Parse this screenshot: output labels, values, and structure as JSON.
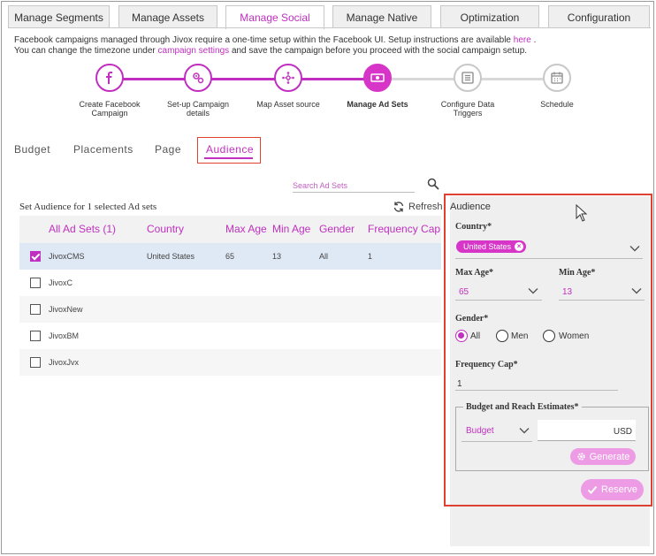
{
  "tabs": [
    {
      "label": "Manage Segments"
    },
    {
      "label": "Manage Assets"
    },
    {
      "label": "Manage Social",
      "active": true
    },
    {
      "label": "Manage Native"
    },
    {
      "label": "Optimization"
    },
    {
      "label": "Configuration"
    }
  ],
  "info": {
    "line1_prefix": "Facebook campaigns managed through Jivox require a one-time setup within the Facebook UI. Setup instructions are available",
    "line1_link": "here",
    "line1_suffix": ".",
    "line2_prefix": "You can change the timezone under",
    "line2_link": "campaign settings",
    "line2_suffix": "and save the campaign before you proceed with the social campaign setup."
  },
  "steps": [
    {
      "label": "Create Facebook Campaign",
      "icon": "facebook-icon",
      "state": "done"
    },
    {
      "label": "Set-up Campaign details",
      "icon": "gears-icon",
      "state": "done"
    },
    {
      "label": "Map Asset source",
      "icon": "network-icon",
      "state": "done"
    },
    {
      "label": "Manage Ad Sets",
      "icon": "money-icon",
      "state": "current"
    },
    {
      "label": "Configure Data Triggers",
      "icon": "list-icon",
      "state": "todo"
    },
    {
      "label": "Schedule",
      "icon": "calendar-icon",
      "state": "todo"
    }
  ],
  "subtabs": [
    {
      "label": "Budget"
    },
    {
      "label": "Placements"
    },
    {
      "label": "Page"
    },
    {
      "label": "Audience",
      "active": true
    }
  ],
  "search": {
    "placeholder": "Search Ad Sets"
  },
  "set_audience_text": "Set Audience for 1 selected Ad sets",
  "refresh_label": "Refresh",
  "table": {
    "headers": [
      "All Ad Sets (1)",
      "Country",
      "Max Age",
      "Min Age",
      "Gender",
      "Frequency Cap"
    ],
    "rows": [
      {
        "name": "JivoxCMS",
        "country": "United States",
        "max_age": "65",
        "min_age": "13",
        "gender": "All",
        "freq": "1",
        "checked": true
      },
      {
        "name": "JivoxC",
        "country": "",
        "max_age": "",
        "min_age": "",
        "gender": "",
        "freq": "",
        "checked": false
      },
      {
        "name": "JivoxNew",
        "country": "",
        "max_age": "",
        "min_age": "",
        "gender": "",
        "freq": "",
        "checked": false
      },
      {
        "name": "JivoxBM",
        "country": "",
        "max_age": "",
        "min_age": "",
        "gender": "",
        "freq": "",
        "checked": false
      },
      {
        "name": "JivoxJvx",
        "country": "",
        "max_age": "",
        "min_age": "",
        "gender": "",
        "freq": "",
        "checked": false
      }
    ]
  },
  "audience_panel": {
    "title": "Audience",
    "country_label": "Country*",
    "country_chip": "United States",
    "max_age_label": "Max Age*",
    "max_age_value": "65",
    "min_age_label": "Min Age*",
    "min_age_value": "13",
    "gender_label": "Gender*",
    "gender_options": [
      "All",
      "Men",
      "Women"
    ],
    "gender_selected": "All",
    "freq_label": "Frequency Cap*",
    "freq_value": "1",
    "budget_legend": "Budget and Reach Estimates*",
    "budget_type": "Budget",
    "currency": "USD",
    "generate_label": "Generate",
    "reserve_label": "Reserve"
  },
  "colors": {
    "accent": "#c02fc0",
    "highlight_border": "#e04030",
    "selected_row": "#dfe8f5",
    "button_disabled": "#ec9be4"
  }
}
